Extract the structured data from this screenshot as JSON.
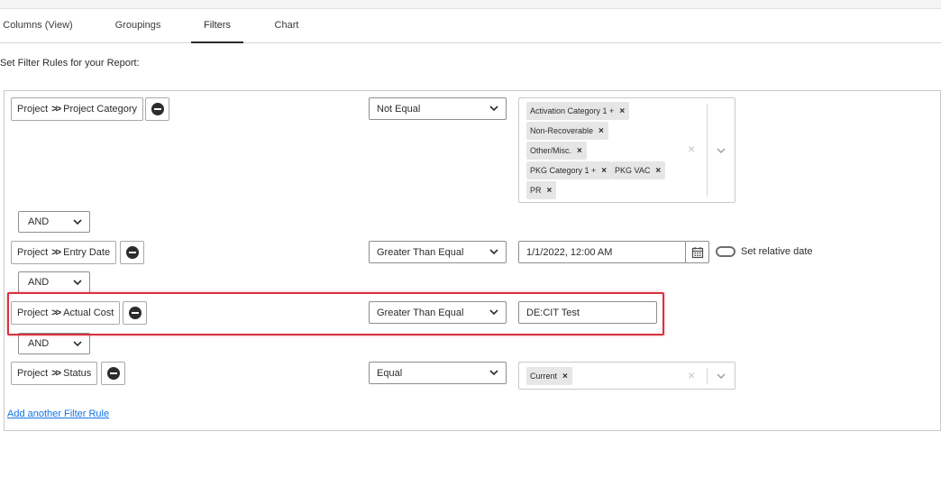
{
  "tabs": [
    {
      "label": "Columns (View)",
      "active": false
    },
    {
      "label": "Groupings",
      "active": false
    },
    {
      "label": "Filters",
      "active": true
    },
    {
      "label": "Chart",
      "active": false
    }
  ],
  "section_label": "Set Filter Rules for your Report:",
  "separator": ">>",
  "rules": [
    {
      "object": "Project",
      "field": "Project Category",
      "operator": "Not Equal",
      "values": [
        "Activation Category 1 +",
        "Non-Recoverable",
        "Other/Misc.",
        "PKG Category 1 +",
        "PKG VAC",
        "PR"
      ]
    },
    {
      "object": "Project",
      "field": "Entry Date",
      "operator": "Greater Than Equal",
      "date_value": "1/1/2022, 12:00 AM",
      "relative_label": "Set relative date",
      "relative_on": false
    },
    {
      "object": "Project",
      "field": "Actual Cost",
      "operator": "Greater Than Equal",
      "text_value": "DE:CIT Test",
      "highlighted": true
    },
    {
      "object": "Project",
      "field": "Status",
      "operator": "Equal",
      "values": [
        "Current"
      ]
    }
  ],
  "conjunctions": [
    "AND",
    "AND",
    "AND"
  ],
  "chip_remove": "×",
  "clear_all": "×",
  "add_rule_label": "Add another Filter Rule",
  "colors": {
    "highlight": "#d8323e",
    "link": "#1473e6",
    "chip_bg": "#e6e6e6"
  }
}
